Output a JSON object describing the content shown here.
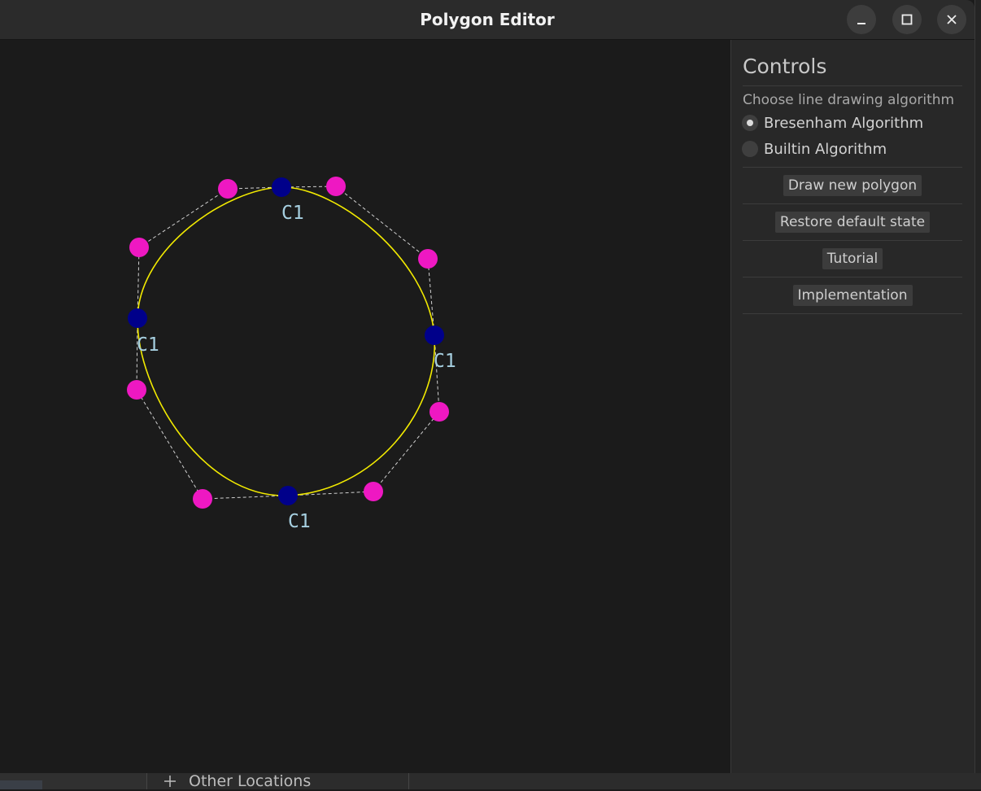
{
  "window": {
    "title": "Polygon Editor",
    "controls": [
      "minimize",
      "maximize",
      "close"
    ]
  },
  "panel": {
    "heading": "Controls",
    "algorithm_caption": "Choose line drawing algorithm",
    "algorithms": [
      {
        "label": "Bresenham Algorithm",
        "selected": true
      },
      {
        "label": "Builtin Algorithm",
        "selected": false
      }
    ],
    "buttons": {
      "draw_new": "Draw new polygon",
      "restore": "Restore default state",
      "tutorial": "Tutorial",
      "implementation": "Implementation"
    }
  },
  "canvas": {
    "vertex_label": "C1",
    "colors": {
      "curve": "#f2ea00",
      "vertex": "#00008a",
      "control_point": "#ee18c2",
      "polygon_edge": "#d0d0d0",
      "label": "#a6cfe0"
    }
  },
  "background_window": {
    "sidebar_item": "Other Locations",
    "sidebar_item_icon": "plus-icon"
  }
}
